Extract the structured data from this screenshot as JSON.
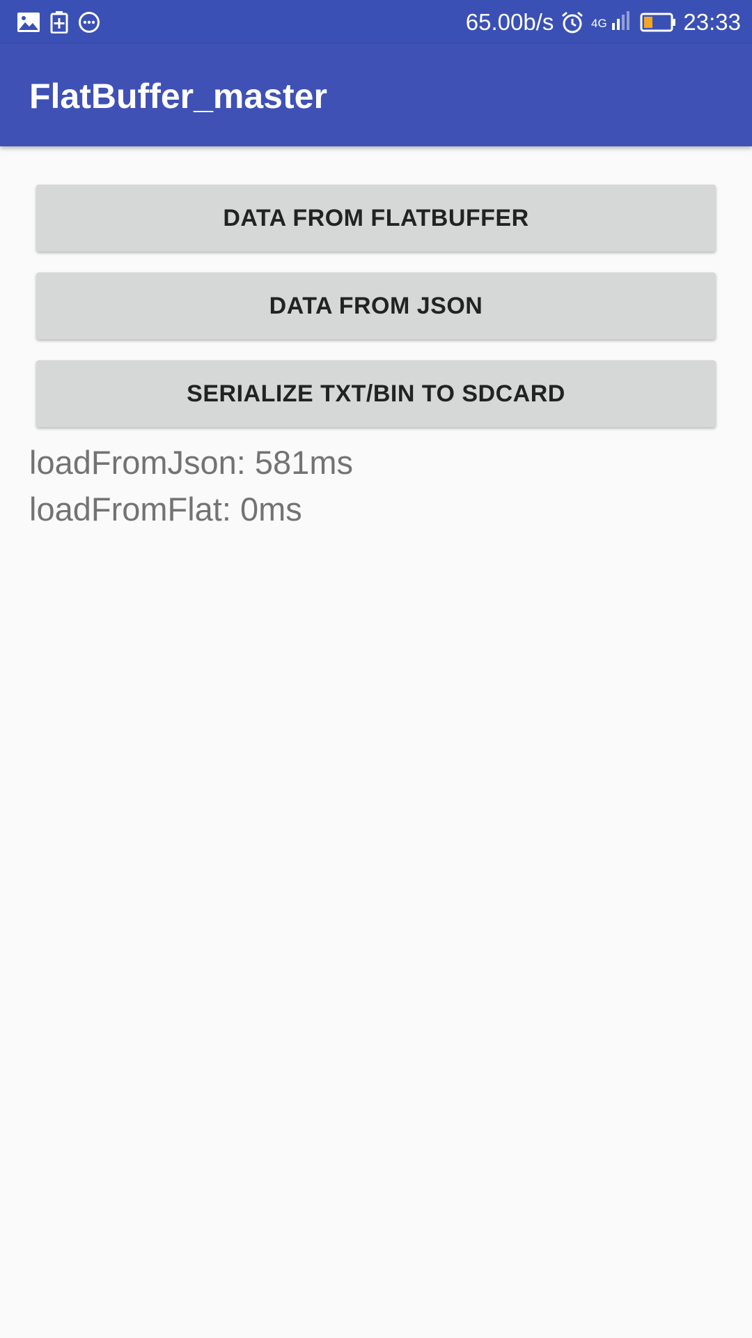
{
  "status_bar": {
    "left_icons": [
      "image-icon",
      "battery-saver-icon",
      "more-horiz-icon"
    ],
    "net_speed": "65.00b/s",
    "network_type": "4G",
    "time": "23:33",
    "battery_color": "#f5a623"
  },
  "app_bar": {
    "title": "FlatBuffer_master",
    "color": "#3f51b5"
  },
  "buttons": [
    {
      "label": "DATA FROM FLATBUFFER"
    },
    {
      "label": "DATA FROM JSON"
    },
    {
      "label": "SERIALIZE TXT/BIN TO SDCARD"
    }
  ],
  "results": [
    {
      "text": "loadFromJson: 581ms"
    },
    {
      "text": "loadFromFlat: 0ms"
    }
  ]
}
